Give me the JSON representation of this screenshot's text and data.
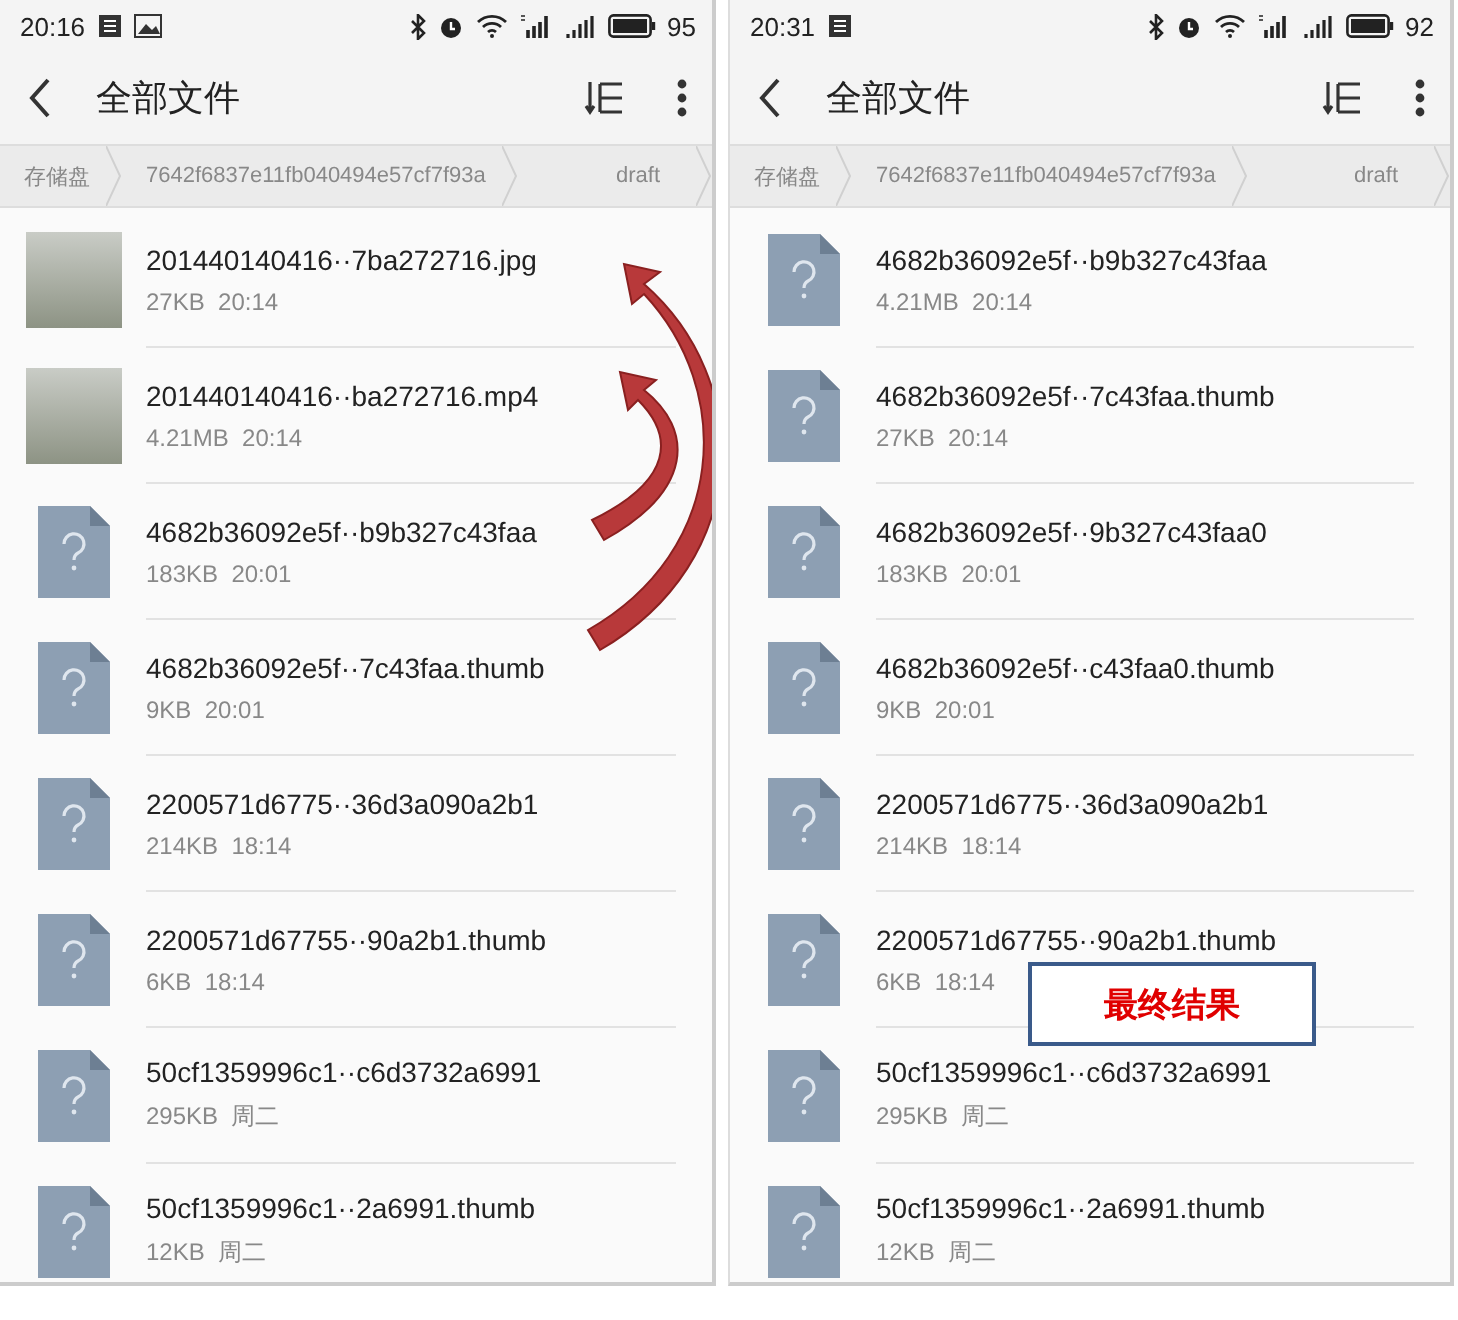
{
  "panels": [
    {
      "status_bar": {
        "time": "20:16",
        "left_icons": [
          {
            "kind": "notes"
          },
          {
            "kind": "image"
          }
        ],
        "battery": "95"
      },
      "title": "全部文件",
      "breadcrumbs": [
        "存储盘",
        "7642f6837e11fb040494e57cf7f93a",
        "draft"
      ],
      "arrows": true,
      "files": [
        {
          "kind": "video-thumb",
          "name": "201440140416··7ba272716.jpg",
          "meta": "27KB  20:14"
        },
        {
          "kind": "video-thumb",
          "name": "201440140416··ba272716.mp4",
          "meta": "4.21MB  20:14"
        },
        {
          "kind": "unknown",
          "name": "4682b36092e5f··b9b327c43faa",
          "meta": "183KB  20:01"
        },
        {
          "kind": "unknown",
          "name": "4682b36092e5f··7c43faa.thumb",
          "meta": "9KB  20:01"
        },
        {
          "kind": "unknown",
          "name": "2200571d6775··36d3a090a2b1",
          "meta": "214KB  18:14"
        },
        {
          "kind": "unknown",
          "name": "2200571d67755··90a2b1.thumb",
          "meta": "6KB  18:14"
        },
        {
          "kind": "unknown",
          "name": "50cf1359996c1··c6d3732a6991",
          "meta": "295KB  周二"
        },
        {
          "kind": "unknown",
          "name": "50cf1359996c1··2a6991.thumb",
          "meta": "12KB  周二"
        }
      ]
    },
    {
      "status_bar": {
        "time": "20:31",
        "left_icons": [
          {
            "kind": "notes"
          }
        ],
        "battery": "92"
      },
      "title": "全部文件",
      "breadcrumbs": [
        "存储盘",
        "7642f6837e11fb040494e57cf7f93a",
        "draft"
      ],
      "arrows": false,
      "annotation": "最终结果",
      "files": [
        {
          "kind": "unknown",
          "name": "4682b36092e5f··b9b327c43faa",
          "meta": "4.21MB  20:14"
        },
        {
          "kind": "unknown",
          "name": "4682b36092e5f··7c43faa.thumb",
          "meta": "27KB  20:14"
        },
        {
          "kind": "unknown",
          "name": "4682b36092e5f··9b327c43faa0",
          "meta": "183KB  20:01"
        },
        {
          "kind": "unknown",
          "name": "4682b36092e5f··c43faa0.thumb",
          "meta": "9KB  20:01"
        },
        {
          "kind": "unknown",
          "name": "2200571d6775··36d3a090a2b1",
          "meta": "214KB  18:14"
        },
        {
          "kind": "unknown",
          "name": "2200571d67755··90a2b1.thumb",
          "meta": "6KB  18:14"
        },
        {
          "kind": "unknown",
          "name": "50cf1359996c1··c6d3732a6991",
          "meta": "295KB  周二"
        },
        {
          "kind": "unknown",
          "name": "50cf1359996c1··2a6991.thumb",
          "meta": "12KB  周二"
        }
      ]
    }
  ]
}
